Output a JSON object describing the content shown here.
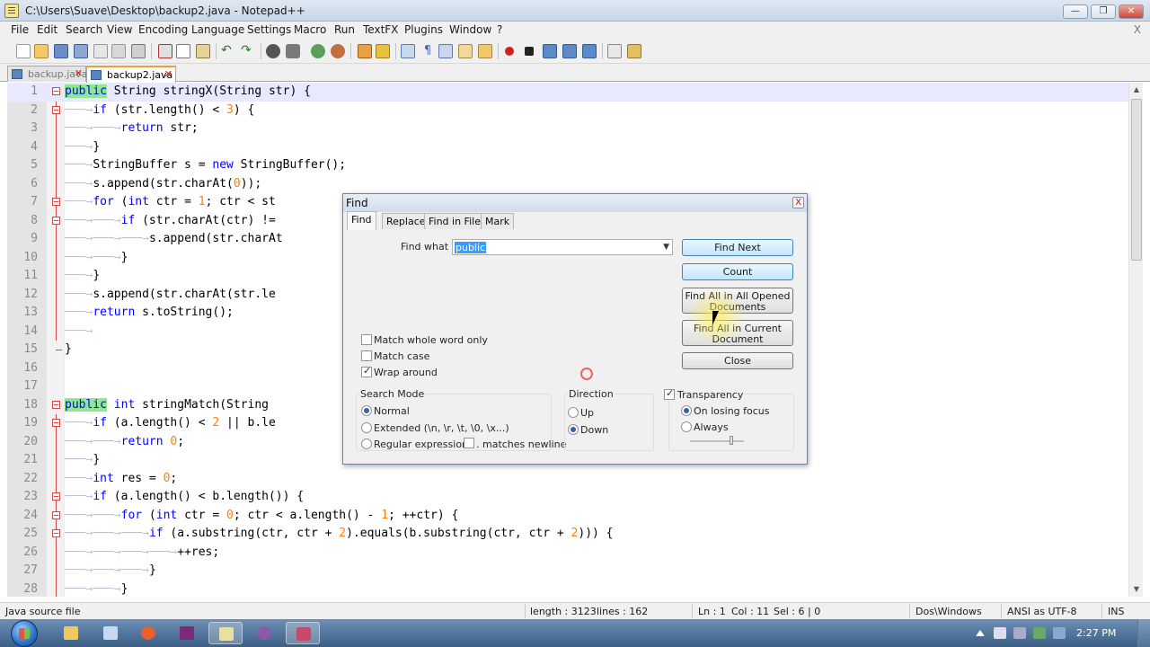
{
  "window": {
    "title": "C:\\Users\\Suave\\Desktop\\backup2.java - Notepad++",
    "close_doc": "X"
  },
  "menu": [
    "File",
    "Edit",
    "Search",
    "View",
    "Encoding",
    "Language",
    "Settings",
    "Macro",
    "Run",
    "TextFX",
    "Plugins",
    "Window",
    "?"
  ],
  "tabs": [
    {
      "label": "backup.java",
      "active": false
    },
    {
      "label": "backup2.java",
      "active": true
    }
  ],
  "editor": {
    "lines": [
      {
        "n": "1"
      },
      {
        "n": "2"
      },
      {
        "n": "3"
      },
      {
        "n": "4"
      },
      {
        "n": "5"
      },
      {
        "n": "6"
      },
      {
        "n": "7"
      },
      {
        "n": "8"
      },
      {
        "n": "9"
      },
      {
        "n": "10"
      },
      {
        "n": "11"
      },
      {
        "n": "12"
      },
      {
        "n": "13"
      },
      {
        "n": "14"
      },
      {
        "n": "15"
      },
      {
        "n": "16"
      },
      {
        "n": "17"
      },
      {
        "n": "18"
      },
      {
        "n": "19"
      },
      {
        "n": "20"
      },
      {
        "n": "21"
      },
      {
        "n": "22"
      },
      {
        "n": "23"
      },
      {
        "n": "24"
      },
      {
        "n": "25"
      },
      {
        "n": "26"
      },
      {
        "n": "27"
      },
      {
        "n": "28"
      }
    ],
    "code": [
      "public String stringX(String str) {",
      "if (str.length() < 3) {",
      "return str;",
      "}",
      "StringBuffer s = new StringBuffer();",
      "s.append(str.charAt(0));",
      "for (int ctr = 1; ctr < st",
      "if (str.charAt(ctr) !=",
      "s.append(str.charAt",
      "}",
      "}",
      "s.append(str.charAt(str.le",
      "return s.toString();",
      "",
      "}",
      "",
      "",
      "public int stringMatch(String",
      "if (a.length() < 2 || b.le",
      "return 0;",
      "}",
      "int res = 0;",
      "if (a.length() < b.length()) {",
      "for (int ctr = 0; ctr < a.length() - 1; ++ctr) {",
      "if (a.substring(ctr, ctr + 2).equals(b.substring(ctr, ctr + 2))) {",
      "++res;",
      "}",
      "}"
    ]
  },
  "find_dialog": {
    "title": "Find",
    "close": "X",
    "tabs": [
      "Find",
      "Replace",
      "Find in Files",
      "Mark"
    ],
    "find_what_label": "Find what :",
    "find_what_value": "public",
    "buttons": {
      "find_next": "Find Next",
      "count": "Count",
      "find_all_opened_1": "Find All in All Opened",
      "find_all_opened_2": "Documents",
      "find_all_current_1": "Find All in Current",
      "find_all_current_2": "Document",
      "close": "Close"
    },
    "options": {
      "match_whole_word": "Match whole word only",
      "match_case": "Match case",
      "wrap_around": "Wrap around"
    },
    "search_mode": {
      "label": "Search Mode",
      "normal": "Normal",
      "extended": "Extended (\\n, \\r, \\t, \\0, \\x...)",
      "regex": "Regular expression",
      "matches_newline": ". matches newline"
    },
    "direction": {
      "label": "Direction",
      "up": "Up",
      "down": "Down"
    },
    "transparency": {
      "label": "Transparency",
      "on_losing_focus": "On losing focus",
      "always": "Always"
    }
  },
  "status": {
    "filetype": "Java source file",
    "length": "length : 3123",
    "lines": "lines : 162",
    "ln": "Ln : 1",
    "col": "Col : 11",
    "sel": "Sel : 6 | 0",
    "eol": "Dos\\Windows",
    "encoding": "ANSI as UTF-8",
    "mode": "INS"
  },
  "taskbar": {
    "clock": "2:27 PM"
  },
  "colors": {
    "keyword": "#0000ff",
    "number": "#ff8000",
    "highlight": "#8fe88f",
    "fold": "#d04848"
  }
}
